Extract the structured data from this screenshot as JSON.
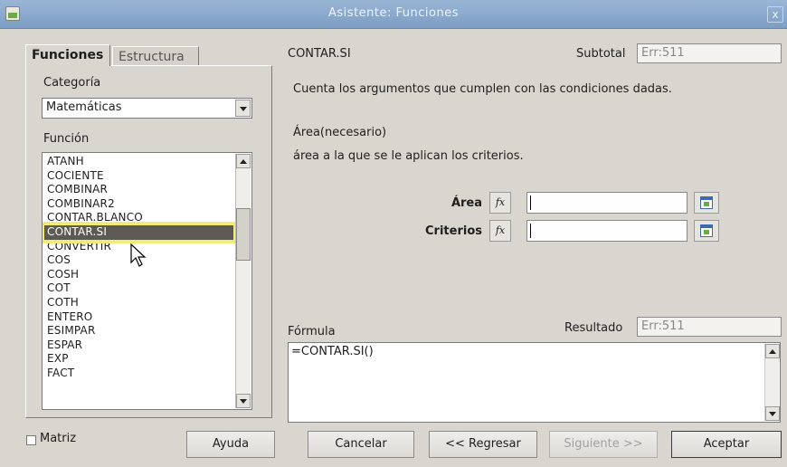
{
  "window": {
    "title": "Asistente: Funciones",
    "close_label": "x"
  },
  "tabs": [
    {
      "label": "Funciones",
      "active": true
    },
    {
      "label": "Estructura",
      "active": false
    }
  ],
  "left": {
    "category_label": "Categoría",
    "category_value": "Matemáticas",
    "function_label": "Función",
    "functions": [
      "ATANH",
      "COCIENTE",
      "COMBINAR",
      "COMBINAR2",
      "CONTAR.BLANCO",
      "CONTAR.SI",
      "CONVERTIR",
      "COS",
      "COSH",
      "COT",
      "COTH",
      "ENTERO",
      "ESIMPAR",
      "ESPAR",
      "EXP",
      "FACT"
    ],
    "selected_function": "CONTAR.SI"
  },
  "right": {
    "function_name": "CONTAR.SI",
    "subtotal_label": "Subtotal",
    "subtotal_value": "Err:511",
    "description": "Cuenta los argumentos que cumplen con las condiciones dadas.",
    "param_title": "Área(necesario)",
    "param_desc": "área a la que se le aplican los criterios.",
    "args": [
      {
        "label": "Área",
        "fx": "fx",
        "value": ""
      },
      {
        "label": "Criterios",
        "fx": "fx",
        "value": ""
      }
    ],
    "formula_label": "Fórmula",
    "result_label": "Resultado",
    "result_value": "Err:511",
    "formula_value": "=CONTAR.SI()"
  },
  "footer": {
    "matrix_label": "Matriz",
    "matrix_checked": false,
    "help": "Ayuda",
    "cancel": "Cancelar",
    "back": "<< Regresar",
    "next": "Siguiente >>",
    "ok": "Aceptar"
  }
}
